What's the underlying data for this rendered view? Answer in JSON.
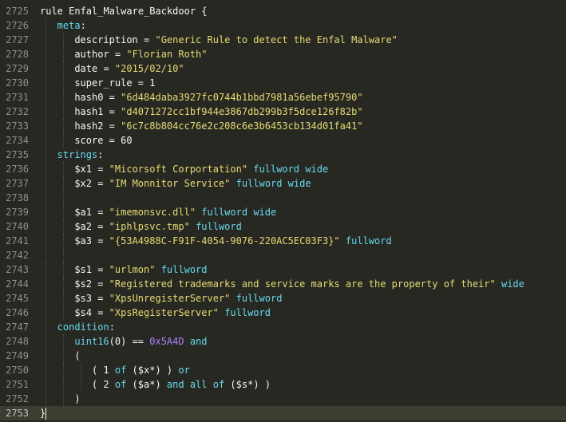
{
  "editor": {
    "lines": [
      {
        "n": "2725",
        "tokens": [
          [
            "k",
            "rule "
          ],
          [
            "ident",
            "Enfal_Malware_Backdoor "
          ],
          [
            "op",
            "{"
          ]
        ]
      },
      {
        "n": "2726",
        "indent": 1,
        "tokens": [
          [
            "sec",
            "meta"
          ],
          [
            "op",
            ":"
          ]
        ]
      },
      {
        "n": "2727",
        "indent": 2,
        "tokens": [
          [
            "ident",
            "description "
          ],
          [
            "op",
            "= "
          ],
          [
            "str",
            "\"Generic Rule to detect the Enfal Malware\""
          ]
        ]
      },
      {
        "n": "2728",
        "indent": 2,
        "tokens": [
          [
            "ident",
            "author "
          ],
          [
            "op",
            "= "
          ],
          [
            "str",
            "\"Florian Roth\""
          ]
        ]
      },
      {
        "n": "2729",
        "indent": 2,
        "tokens": [
          [
            "ident",
            "date "
          ],
          [
            "op",
            "= "
          ],
          [
            "str",
            "\"2015/02/10\""
          ]
        ]
      },
      {
        "n": "2730",
        "indent": 2,
        "tokens": [
          [
            "ident",
            "super_rule "
          ],
          [
            "op",
            "= "
          ],
          [
            "num",
            "1"
          ]
        ]
      },
      {
        "n": "2731",
        "indent": 2,
        "tokens": [
          [
            "ident",
            "hash0 "
          ],
          [
            "op",
            "= "
          ],
          [
            "str",
            "\"6d484daba3927fc0744b1bbd7981a56ebef95790\""
          ]
        ]
      },
      {
        "n": "2732",
        "indent": 2,
        "tokens": [
          [
            "ident",
            "hash1 "
          ],
          [
            "op",
            "= "
          ],
          [
            "str",
            "\"d4071272cc1bf944e3867db299b3f5dce126f82b\""
          ]
        ]
      },
      {
        "n": "2733",
        "indent": 2,
        "tokens": [
          [
            "ident",
            "hash2 "
          ],
          [
            "op",
            "= "
          ],
          [
            "str",
            "\"6c7c8b804cc76e2c208c6e3b6453cb134d01fa41\""
          ]
        ]
      },
      {
        "n": "2734",
        "indent": 2,
        "tokens": [
          [
            "ident",
            "score "
          ],
          [
            "op",
            "= "
          ],
          [
            "num",
            "60"
          ]
        ]
      },
      {
        "n": "2735",
        "indent": 1,
        "tokens": [
          [
            "sec",
            "strings"
          ],
          [
            "op",
            ":"
          ]
        ]
      },
      {
        "n": "2736",
        "indent": 2,
        "tokens": [
          [
            "var",
            "$x1 "
          ],
          [
            "op",
            "= "
          ],
          [
            "str",
            "\"Micorsoft Corportation\""
          ],
          [
            "op",
            " "
          ],
          [
            "mod",
            "fullword"
          ],
          [
            "op",
            " "
          ],
          [
            "mod",
            "wide"
          ]
        ]
      },
      {
        "n": "2737",
        "indent": 2,
        "tokens": [
          [
            "var",
            "$x2 "
          ],
          [
            "op",
            "= "
          ],
          [
            "str",
            "\"IM Monnitor Service\""
          ],
          [
            "op",
            " "
          ],
          [
            "mod",
            "fullword"
          ],
          [
            "op",
            " "
          ],
          [
            "mod",
            "wide"
          ]
        ]
      },
      {
        "n": "2738",
        "indent": 2,
        "tokens": []
      },
      {
        "n": "2739",
        "indent": 2,
        "tokens": [
          [
            "var",
            "$a1 "
          ],
          [
            "op",
            "= "
          ],
          [
            "str",
            "\"imemonsvc.dll\""
          ],
          [
            "op",
            " "
          ],
          [
            "mod",
            "fullword"
          ],
          [
            "op",
            " "
          ],
          [
            "mod",
            "wide"
          ]
        ]
      },
      {
        "n": "2740",
        "indent": 2,
        "tokens": [
          [
            "var",
            "$a2 "
          ],
          [
            "op",
            "= "
          ],
          [
            "str",
            "\"iphlpsvc.tmp\""
          ],
          [
            "op",
            " "
          ],
          [
            "mod",
            "fullword"
          ]
        ]
      },
      {
        "n": "2741",
        "indent": 2,
        "tokens": [
          [
            "var",
            "$a3 "
          ],
          [
            "op",
            "= "
          ],
          [
            "str",
            "\"{53A4988C-F91F-4054-9076-220AC5EC03F3}\""
          ],
          [
            "op",
            " "
          ],
          [
            "mod",
            "fullword"
          ]
        ]
      },
      {
        "n": "2742",
        "indent": 2,
        "tokens": []
      },
      {
        "n": "2743",
        "indent": 2,
        "tokens": [
          [
            "var",
            "$s1 "
          ],
          [
            "op",
            "= "
          ],
          [
            "str",
            "\"urlmon\""
          ],
          [
            "op",
            " "
          ],
          [
            "mod",
            "fullword"
          ]
        ]
      },
      {
        "n": "2744",
        "indent": 2,
        "tokens": [
          [
            "var",
            "$s2 "
          ],
          [
            "op",
            "= "
          ],
          [
            "str",
            "\"Registered trademarks and service marks are the property of their\""
          ],
          [
            "op",
            " "
          ],
          [
            "mod",
            "wide"
          ]
        ]
      },
      {
        "n": "2745",
        "indent": 2,
        "tokens": [
          [
            "var",
            "$s3 "
          ],
          [
            "op",
            "= "
          ],
          [
            "str",
            "\"XpsUnregisterServer\""
          ],
          [
            "op",
            " "
          ],
          [
            "mod",
            "fullword"
          ]
        ]
      },
      {
        "n": "2746",
        "indent": 2,
        "tokens": [
          [
            "var",
            "$s4 "
          ],
          [
            "op",
            "= "
          ],
          [
            "str",
            "\"XpsRegisterServer\""
          ],
          [
            "op",
            " "
          ],
          [
            "mod",
            "fullword"
          ]
        ]
      },
      {
        "n": "2747",
        "indent": 1,
        "tokens": [
          [
            "sec",
            "condition"
          ],
          [
            "op",
            ":"
          ]
        ]
      },
      {
        "n": "2748",
        "indent": 2,
        "tokens": [
          [
            "fn",
            "uint16"
          ],
          [
            "op",
            "(0) == "
          ],
          [
            "hexnum",
            "0x5A4D"
          ],
          [
            "op",
            " "
          ],
          [
            "mod",
            "and"
          ]
        ]
      },
      {
        "n": "2749",
        "indent": 2,
        "tokens": [
          [
            "op",
            "("
          ]
        ]
      },
      {
        "n": "2750",
        "indent": 3,
        "tokens": [
          [
            "op",
            "( 1 "
          ],
          [
            "mod",
            "of"
          ],
          [
            "op",
            " ($x*) ) "
          ],
          [
            "mod",
            "or"
          ]
        ]
      },
      {
        "n": "2751",
        "indent": 3,
        "tokens": [
          [
            "op",
            "( 2 "
          ],
          [
            "mod",
            "of"
          ],
          [
            "op",
            " ($a*) "
          ],
          [
            "mod",
            "and"
          ],
          [
            "op",
            " "
          ],
          [
            "mod",
            "all"
          ],
          [
            "op",
            " "
          ],
          [
            "mod",
            "of"
          ],
          [
            "op",
            " ($s*) )"
          ]
        ]
      },
      {
        "n": "2752",
        "indent": 2,
        "tokens": [
          [
            "op",
            ")"
          ]
        ]
      },
      {
        "n": "2753",
        "indent": 0,
        "current": true,
        "tokens": [
          [
            "op",
            "}"
          ]
        ]
      }
    ]
  }
}
